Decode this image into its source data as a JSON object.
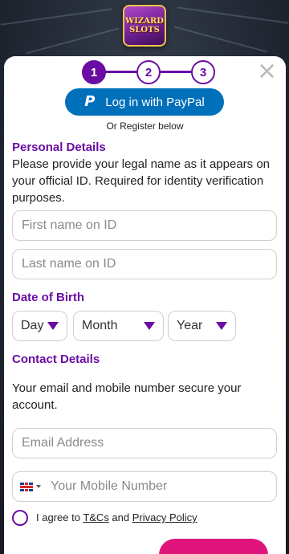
{
  "brand": {
    "logo_line1": "WIZARD",
    "logo_line2": "SLOTS"
  },
  "steps": [
    "1",
    "2",
    "3"
  ],
  "paypal_button": "Log in with PayPal",
  "or_register": "Or Register below",
  "personal": {
    "title": "Personal Details",
    "description": "Please provide your legal name as it appears on your official ID. Required for identity verification purposes.",
    "first_name_placeholder": "First name on ID",
    "last_name_placeholder": "Last name on ID"
  },
  "dob": {
    "title": "Date of Birth",
    "day": "Day",
    "month": "Month",
    "year": "Year"
  },
  "contact": {
    "title": "Contact Details",
    "description": "Your email and mobile number secure your account.",
    "email_placeholder": "Email Address",
    "mobile_placeholder": "Your Mobile Number"
  },
  "terms": {
    "prefix": "I agree to ",
    "tcs": "T&Cs",
    "and": " and ",
    "privacy": "Privacy Policy"
  },
  "icons": {
    "close": "close-icon",
    "paypal": "paypal-icon",
    "flag": "uk-flag-icon"
  },
  "colors": {
    "accent": "#6a0da4",
    "paypal": "#0070ba",
    "submit": "#e0157c"
  }
}
